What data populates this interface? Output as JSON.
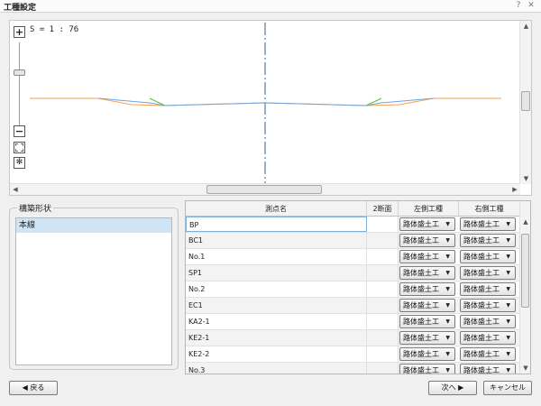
{
  "window": {
    "title": "工種設定",
    "help_icon": "question-icon",
    "close_icon": "close-icon"
  },
  "viewer": {
    "scale_text": "S = 1 : 76",
    "zoom_in_label": "+",
    "zoom_out_label": "−",
    "fit_icon": "fit-icon",
    "settings_icon": "gear-icon",
    "profile_colors": {
      "terrain": "#f7a04a",
      "design": "#6fa3dd",
      "slope": "#58c23c",
      "centerline": "#7a93ad"
    }
  },
  "shape_group": {
    "legend": "構築形状",
    "items": [
      "本線"
    ],
    "selected": "本線"
  },
  "table": {
    "columns": [
      "測点名",
      "2断面",
      "左側工種",
      "右側工種"
    ],
    "rows": [
      {
        "name": "BP",
        "left": "路体盛土工",
        "right": "路体盛土工"
      },
      {
        "name": "BC1",
        "left": "路体盛土工",
        "right": "路体盛土工"
      },
      {
        "name": "No.1",
        "left": "路体盛土工",
        "right": "路体盛土工"
      },
      {
        "name": "SP1",
        "left": "路体盛土工",
        "right": "路体盛土工"
      },
      {
        "name": "No.2",
        "left": "路体盛土工",
        "right": "路体盛土工"
      },
      {
        "name": "EC1",
        "left": "路体盛土工",
        "right": "路体盛土工"
      },
      {
        "name": "KA2-1",
        "left": "路体盛土工",
        "right": "路体盛土工"
      },
      {
        "name": "KE2-1",
        "left": "路体盛土工",
        "right": "路体盛土工"
      },
      {
        "name": "KE2-2",
        "left": "路体盛土工",
        "right": "路体盛土工"
      },
      {
        "name": "No.3",
        "left": "路体盛土工",
        "right": "路体盛土工"
      }
    ],
    "selected_row": 0
  },
  "buttons": {
    "back": "◀ 戻る",
    "next": "次へ ▶",
    "cancel": "キャンセル"
  }
}
